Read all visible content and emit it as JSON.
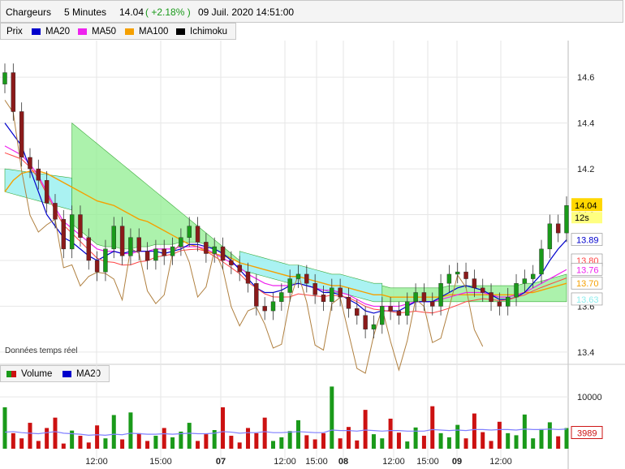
{
  "header": {
    "name": "Chargeurs",
    "interval": "5 Minutes",
    "price": "14.04",
    "change": "( +2.18% )",
    "datetime": "09 Juil. 2020 14:51:00"
  },
  "colors": {
    "price": "#8b1a1a",
    "price_up": "#1a9a1a",
    "ma20": "#0000cc",
    "ma50": "#ee22ee",
    "ma100": "#f5a000",
    "ichimoku": "#000000",
    "cloud_bull": "#90ee90",
    "cloud_bear": "#8eeeee",
    "tenkan": "#ff4444",
    "kijun": "#8b6914",
    "chikou": "#b08040",
    "grid": "#e6e6e6"
  },
  "price_legend": [
    {
      "label": "Prix",
      "color": ""
    },
    {
      "label": "MA20",
      "color": "#0000cc"
    },
    {
      "label": "MA50",
      "color": "#ee22ee"
    },
    {
      "label": "MA100",
      "color": "#f5a000"
    },
    {
      "label": "Ichimoku",
      "color": "#000000"
    }
  ],
  "volume_legend": [
    {
      "label": "Volume",
      "icon": "volume-bars-icon"
    },
    {
      "label": "MA20",
      "color": "#0000cc"
    }
  ],
  "realtime_note": "Données temps réel",
  "time_labels": [
    "12:00",
    "15:00",
    "07",
    "12:00",
    "15:00",
    "08",
    "12:00",
    "15:00",
    "09",
    "12:00"
  ],
  "chart_data": [
    {
      "type": "candlestick",
      "title": "Chargeurs 5 Minutes",
      "y_ticks": [
        "13.4",
        "13.6",
        "13.8",
        "14.0",
        "14.2",
        "14.4",
        "14.6"
      ],
      "ylim": [
        13.35,
        14.76
      ],
      "last_price_label": "14.04",
      "countdown_label": "12s",
      "indicator_labels": [
        {
          "name": "MA20",
          "value": "13.89",
          "color": "#0000cc"
        },
        {
          "name": "Ichimoku",
          "value": "13.80",
          "color": "#ff4444"
        },
        {
          "name": "MA50",
          "value": "13.76",
          "color": "#ee22ee"
        },
        {
          "name": "MA100",
          "value": "13.70",
          "color": "#f5a000"
        },
        {
          "name": "Cloud",
          "value": "13.63",
          "color": "#8eeeee"
        }
      ],
      "closes": [
        14.62,
        14.45,
        14.25,
        14.2,
        14.15,
        14.05,
        13.98,
        13.85,
        14.0,
        13.9,
        13.8,
        13.75,
        13.85,
        13.95,
        13.82,
        13.9,
        13.84,
        13.8,
        13.85,
        13.82,
        13.86,
        13.9,
        13.95,
        13.88,
        13.83,
        13.86,
        13.8,
        13.78,
        13.75,
        13.7,
        13.6,
        13.58,
        13.62,
        13.66,
        13.72,
        13.74,
        13.7,
        13.65,
        13.62,
        13.68,
        13.64,
        13.59,
        13.56,
        13.5,
        13.52,
        13.6,
        13.58,
        13.56,
        13.62,
        13.66,
        13.62,
        13.6,
        13.7,
        13.74,
        13.75,
        13.72,
        13.68,
        13.66,
        13.62,
        13.6,
        13.64,
        13.7,
        13.72,
        13.74,
        13.85,
        13.96,
        13.92,
        14.04
      ],
      "ma20": [
        14.4,
        14.35,
        14.3,
        14.2,
        14.1,
        14.0,
        13.95,
        13.9,
        13.88,
        13.85,
        13.82,
        13.8,
        13.82,
        13.84,
        13.83,
        13.84,
        13.84,
        13.84,
        13.84,
        13.83,
        13.84,
        13.85,
        13.87,
        13.87,
        13.86,
        13.85,
        13.83,
        13.8,
        13.76,
        13.72,
        13.68,
        13.66,
        13.66,
        13.67,
        13.69,
        13.7,
        13.69,
        13.68,
        13.66,
        13.66,
        13.65,
        13.63,
        13.61,
        13.58,
        13.57,
        13.58,
        13.58,
        13.58,
        13.6,
        13.62,
        13.62,
        13.62,
        13.64,
        13.66,
        13.68,
        13.69,
        13.68,
        13.67,
        13.65,
        13.63,
        13.63,
        13.64,
        13.66,
        13.7,
        13.74,
        13.8,
        13.85,
        13.89
      ],
      "ma50": [
        14.3,
        14.28,
        14.26,
        14.22,
        14.17,
        14.1,
        14.03,
        13.97,
        13.94,
        13.91,
        13.88,
        13.85,
        13.84,
        13.84,
        13.83,
        13.83,
        13.84,
        13.84,
        13.85,
        13.85,
        13.85,
        13.86,
        13.86,
        13.86,
        13.85,
        13.83,
        13.81,
        13.79,
        13.77,
        13.74,
        13.72,
        13.7,
        13.69,
        13.69,
        13.69,
        13.7,
        13.69,
        13.68,
        13.67,
        13.67,
        13.66,
        13.65,
        13.63,
        13.61,
        13.6,
        13.6,
        13.6,
        13.6,
        13.61,
        13.62,
        13.62,
        13.62,
        13.63,
        13.64,
        13.65,
        13.66,
        13.66,
        13.66,
        13.65,
        13.64,
        13.64,
        13.65,
        13.66,
        13.68,
        13.7,
        13.72,
        13.74,
        13.76
      ],
      "ma100": [
        14.1,
        14.15,
        14.18,
        14.19,
        14.19,
        14.18,
        14.16,
        14.14,
        14.12,
        14.1,
        14.08,
        14.06,
        14.05,
        14.04,
        14.02,
        14.0,
        13.98,
        13.97,
        13.95,
        13.93,
        13.91,
        13.89,
        13.87,
        13.86,
        13.84,
        13.83,
        13.82,
        13.81,
        13.79,
        13.78,
        13.77,
        13.76,
        13.75,
        13.74,
        13.73,
        13.73,
        13.72,
        13.71,
        13.7,
        13.69,
        13.69,
        13.68,
        13.67,
        13.66,
        13.65,
        13.65,
        13.64,
        13.64,
        13.64,
        13.64,
        13.64,
        13.64,
        13.64,
        13.65,
        13.65,
        13.65,
        13.65,
        13.65,
        13.65,
        13.65,
        13.65,
        13.65,
        13.66,
        13.66,
        13.67,
        13.68,
        13.69,
        13.7
      ],
      "volumes": [
        8000,
        3000,
        2000,
        5000,
        1500,
        4000,
        6000,
        1000,
        3500,
        2500,
        1200,
        4500,
        2000,
        6500,
        1800,
        7000,
        3000,
        1500,
        2500,
        4000,
        2200,
        3300,
        5000,
        1500,
        2800,
        3600,
        8000,
        2500,
        1200,
        4000,
        3000,
        6000,
        1500,
        2200,
        3400,
        5500,
        2600,
        1800,
        3000,
        12000,
        2000,
        4200,
        1600,
        7500,
        2800,
        2000,
        5800,
        3100,
        1400,
        4100,
        2500,
        8200,
        3000,
        2200,
        4600,
        2000,
        6800,
        3200,
        1500,
        5200,
        3000,
        2600,
        6600,
        2000,
        3800,
        5100,
        2400,
        3989
      ],
      "volume_ma20": [
        3200,
        3300,
        3100,
        3000,
        2900,
        3100,
        3300,
        3000,
        2900,
        2800,
        2600,
        2700,
        2600,
        2800,
        2700,
        3000,
        2900,
        2800,
        2800,
        2900,
        2800,
        2900,
        3000,
        2900,
        2900,
        3000,
        3300,
        3200,
        3000,
        3100,
        3100,
        3300,
        3100,
        3100,
        3200,
        3300,
        3200,
        3100,
        3100,
        3600,
        3500,
        3500,
        3400,
        3600,
        3500,
        3400,
        3500,
        3500,
        3400,
        3400,
        3400,
        3700,
        3600,
        3500,
        3600,
        3500,
        3700,
        3700,
        3600,
        3700,
        3700,
        3600,
        3800,
        3700,
        3700,
        3800,
        3700,
        3800
      ],
      "volume_ticks": [
        "10000"
      ],
      "volume_last_label": "3989"
    }
  ]
}
